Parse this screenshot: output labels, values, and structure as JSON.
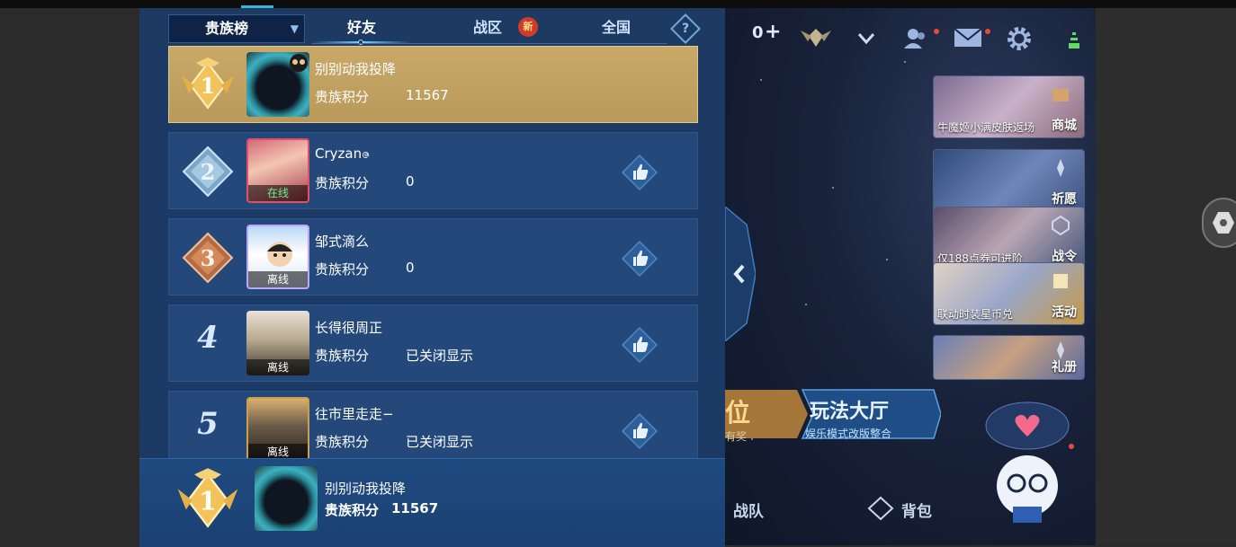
{
  "tabs": {
    "selector_label": "贵族榜",
    "items": [
      "好友",
      "战区",
      "全国"
    ],
    "active": "好友",
    "new_badge": "新",
    "help_symbol": "?"
  },
  "leaderboard": {
    "score_label": "贵族积分",
    "rows": [
      {
        "rank": "1",
        "name": "别别动我投降",
        "score": "11567",
        "status": ""
      },
      {
        "rank": "2",
        "name": "Cryzanဇ",
        "score": "0",
        "status": "在线"
      },
      {
        "rank": "3",
        "name": "邹式滴么",
        "score": "0",
        "status": "离线"
      },
      {
        "rank": "4",
        "name": "长得很周正",
        "score": "已关闭显示",
        "status": "离线"
      },
      {
        "rank": "5",
        "name": "往市里走走−",
        "score": "已关闭显示",
        "status": "离线"
      }
    ]
  },
  "my_rank": {
    "rank": "1",
    "name": "别别动我投降",
    "score_label": "贵族积分",
    "score": "11567"
  },
  "hud": {
    "currency": "0",
    "currency_add_icon": "plus-icon",
    "icons": [
      "rank-emblem-icon",
      "chevron-down-icon",
      "friends-icon",
      "mail-icon",
      "gear-icon",
      "wifi-icon"
    ]
  },
  "side_menu": [
    {
      "label": "商城",
      "caption": "牛魔姬小满皮肤返场"
    },
    {
      "label": "祈愿",
      "caption": ""
    },
    {
      "label": "战令",
      "caption": "仅188点券可进阶"
    },
    {
      "label": "活动",
      "caption": "联动时装星币兑"
    },
    {
      "label": "礼册",
      "caption": ""
    }
  ],
  "modes": {
    "rank_char": "位",
    "rank_sub": "有奖",
    "title": "玩法大厅",
    "subtitle": "娱乐模式改版整合"
  },
  "bottom_nav": {
    "team": "战队",
    "bag": "背包"
  },
  "colors": {
    "panel_bg": "#1b3a66",
    "row_bg": "#24487a",
    "first_row_gold": "#c9a868",
    "accent": "#38b6d6",
    "new_badge": "#d23a2a"
  }
}
